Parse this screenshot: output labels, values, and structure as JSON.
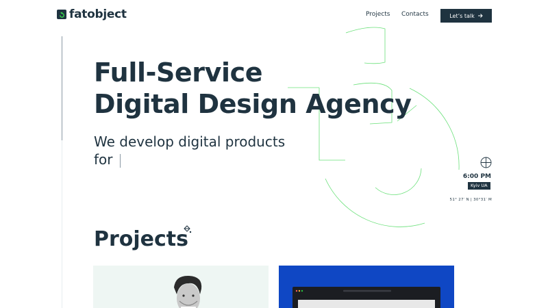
{
  "header": {
    "logo_text": "fatobject",
    "nav": {
      "projects": "Projects",
      "contacts": "Contacts"
    },
    "cta_label": "Let’s talk",
    "cta_icon": "arrow-right-icon"
  },
  "hero": {
    "title_line1": "Full-Service",
    "title_line2": "Digital Design Agency",
    "subtitle_line1": "We develop digital products",
    "subtitle_line2": "for"
  },
  "clock": {
    "time": "6:00 PM",
    "city": "Kyiv UA",
    "coordinates": "51° 27′ N | 30°31′ M"
  },
  "projects": {
    "title": "Projects"
  },
  "colors": {
    "brand_dark": "#1f3340",
    "accent_green": "#37d64c",
    "card_mint": "#eef6f3",
    "card_blue": "#0f47c4"
  }
}
